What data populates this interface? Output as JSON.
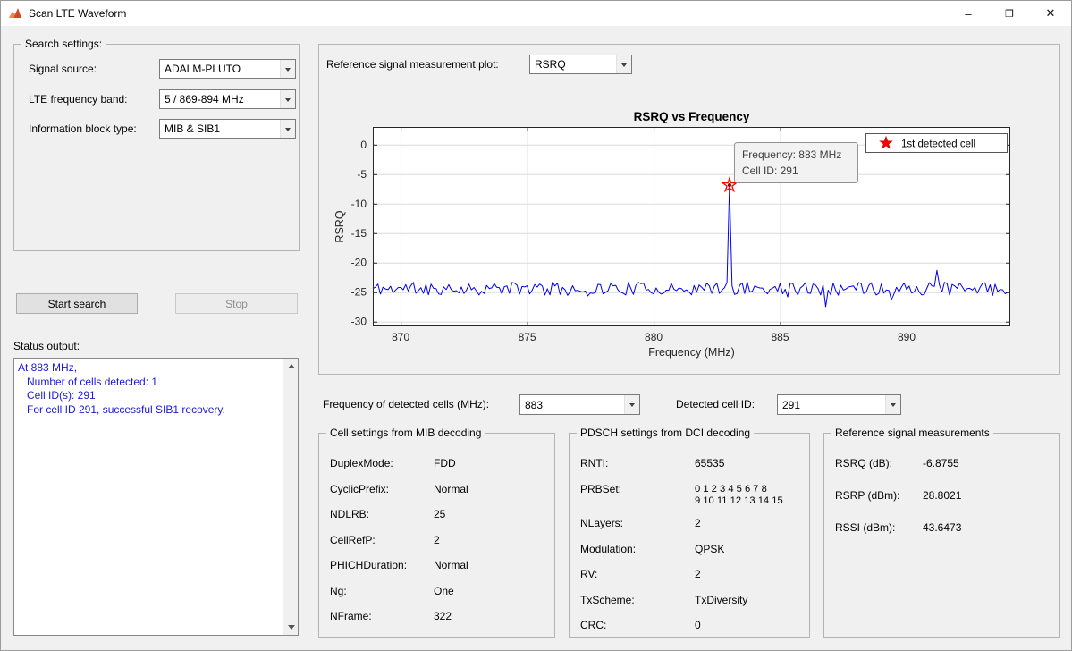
{
  "window": {
    "title": "Scan LTE Waveform",
    "controls": {
      "minimize": "–",
      "maximize": "❐",
      "close": "✕"
    }
  },
  "search_settings": {
    "legend": "Search settings:",
    "fields": [
      {
        "label": "Signal source:",
        "value": "ADALM-PLUTO"
      },
      {
        "label": "LTE frequency band:",
        "value": "5 / 869-894 MHz"
      },
      {
        "label": "Information block type:",
        "value": "MIB & SIB1"
      }
    ]
  },
  "buttons": {
    "start": "Start search",
    "stop": "Stop"
  },
  "status_output": {
    "label": "Status output:",
    "lines": [
      "At 883 MHz,",
      "   Number of cells detected: 1",
      "   Cell ID(s): 291",
      "   For cell ID 291, successful SIB1 recovery."
    ],
    "text_color": "#1a1ad6"
  },
  "plot_panel": {
    "measurement_label": "Reference signal measurement plot:",
    "measurement_value": "RSRQ"
  },
  "detected": {
    "freq_label": "Frequency of detected cells (MHz):",
    "freq_value": "883",
    "cell_label": "Detected cell ID:",
    "cell_value": "291"
  },
  "mib": {
    "legend": "Cell settings from MIB decoding",
    "rows": [
      {
        "label": "DuplexMode:",
        "value": "FDD"
      },
      {
        "label": "CyclicPrefix:",
        "value": "Normal"
      },
      {
        "label": "NDLRB:",
        "value": "25"
      },
      {
        "label": "CellRefP:",
        "value": "2"
      },
      {
        "label": "PHICHDuration:",
        "value": "Normal"
      },
      {
        "label": "Ng:",
        "value": "One"
      },
      {
        "label": "NFrame:",
        "value": "322"
      }
    ]
  },
  "pdsch": {
    "legend": "PDSCH settings from DCI decoding",
    "rows": [
      {
        "label": "RNTI:",
        "value": "65535"
      },
      {
        "label": "PRBSet:",
        "value": "0 1 2 3 4 5 6 7 8\n9 10 11 12 13 14 15",
        "small": true
      },
      {
        "label": "NLayers:",
        "value": "2"
      },
      {
        "label": "Modulation:",
        "value": "QPSK"
      },
      {
        "label": "RV:",
        "value": "2"
      },
      {
        "label": "TxScheme:",
        "value": "TxDiversity"
      },
      {
        "label": "CRC:",
        "value": "0"
      }
    ]
  },
  "ref_measurements": {
    "legend": "Reference signal measurements",
    "rows": [
      {
        "label": "RSRQ (dB):",
        "value": "-6.8755"
      },
      {
        "label": "RSRP (dBm):",
        "value": "28.8021"
      },
      {
        "label": "RSSI (dBm):",
        "value": "43.6473"
      }
    ]
  },
  "chart_data": {
    "type": "line",
    "title": "RSRQ vs Frequency",
    "xlabel": "Frequency (MHz)",
    "ylabel": "RSRQ",
    "xlim": [
      868.9,
      894.1
    ],
    "ylim": [
      -30.8,
      3.0
    ],
    "xticks": [
      870,
      875,
      880,
      885,
      890
    ],
    "yticks": [
      0,
      -5,
      -10,
      -15,
      -20,
      -25,
      -30
    ],
    "grid": true,
    "legend_position": "northeast",
    "line_color": "#0000ee",
    "marker_color": "#ff0000",
    "baseline_dB": -24.4,
    "noise_amp_dB": 1.1,
    "sample_step_mhz": 0.1,
    "seed": 11,
    "peak": {
      "freq_mhz": 883,
      "rsrq_db": -6.8755,
      "cell_id": 291
    },
    "secondary_peak": {
      "freq_mhz": 891.2,
      "rsrq_db": -21.3
    },
    "legend": {
      "label": "1st detected cell",
      "marker": "red-star"
    },
    "datatip": {
      "lines": [
        "Frequency: 883 MHz",
        "Cell ID: 291"
      ]
    }
  }
}
